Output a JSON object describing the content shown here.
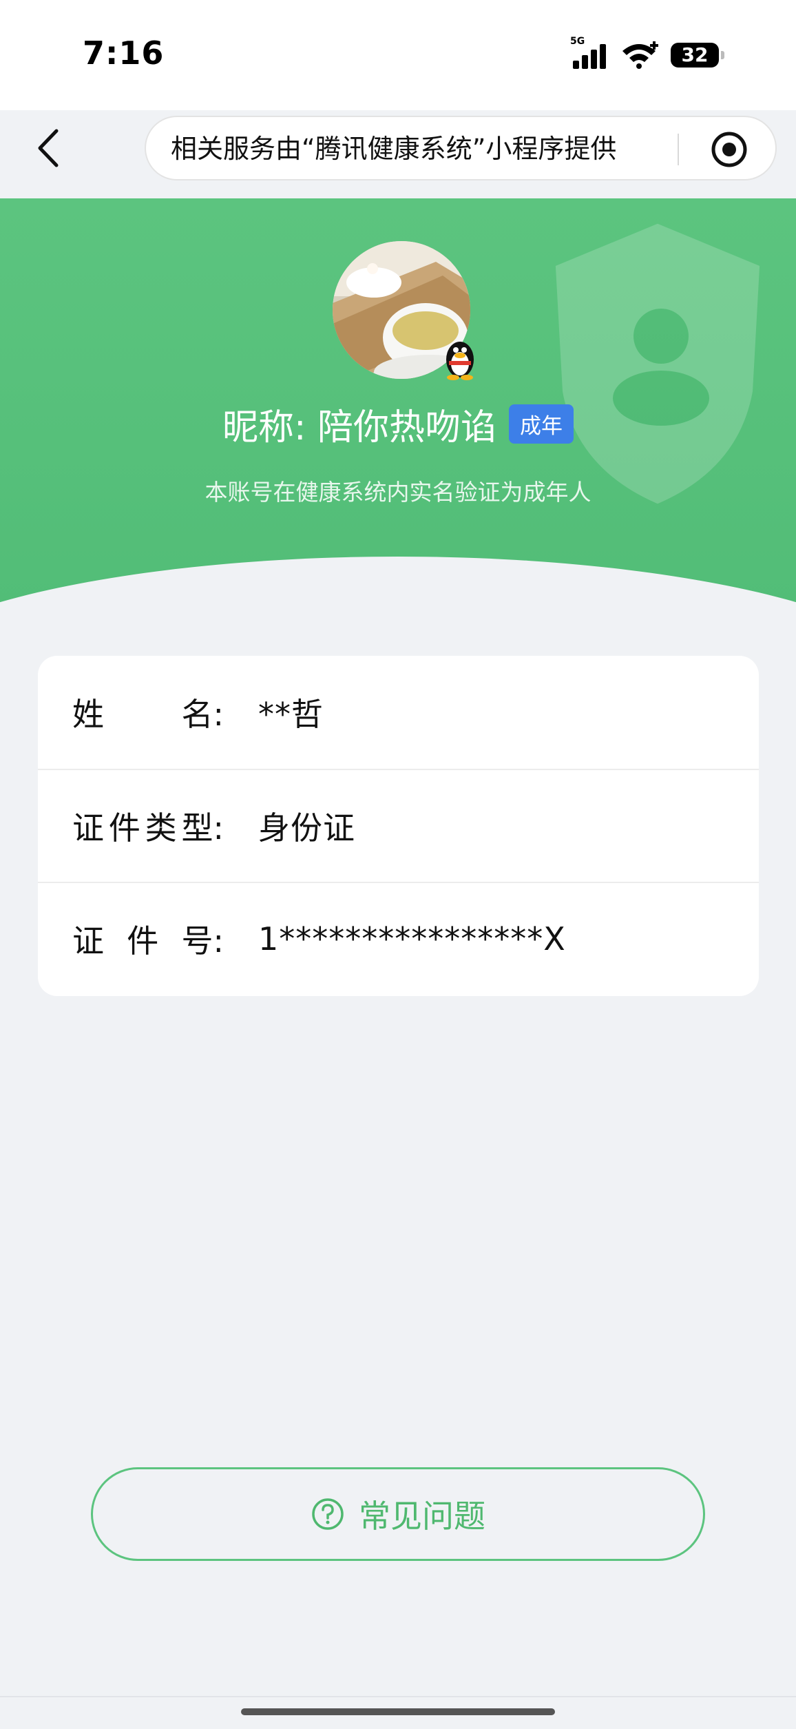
{
  "status_bar": {
    "time": "7:16",
    "network": "5G",
    "battery": "32"
  },
  "nav": {
    "url_text": "相关服务由“腾讯健康系统”小程序提供",
    "back_icon": "chevron-left-icon",
    "target_icon": "record-target-icon"
  },
  "profile": {
    "nickname": "昵称: 陪你热吻谄",
    "badge": "成年",
    "subtitle": "本账号在健康系统内实名验证为成年人"
  },
  "info": {
    "rows": [
      {
        "label_chars": [
          "姓",
          "名:"
        ],
        "value": "**哲"
      },
      {
        "label_chars": [
          "证",
          "件",
          "类",
          "型:"
        ],
        "value": "身份证"
      },
      {
        "label_chars": [
          "证",
          "件",
          "号:"
        ],
        "value": "1****************X"
      }
    ]
  },
  "faq": {
    "label": "常见问题",
    "icon": "question-circle-icon"
  },
  "colors": {
    "header_green": "#5cc47f",
    "badge_blue": "#3d7fe8",
    "faq_green": "#4fb86f",
    "page_bg": "#f0f2f5"
  }
}
